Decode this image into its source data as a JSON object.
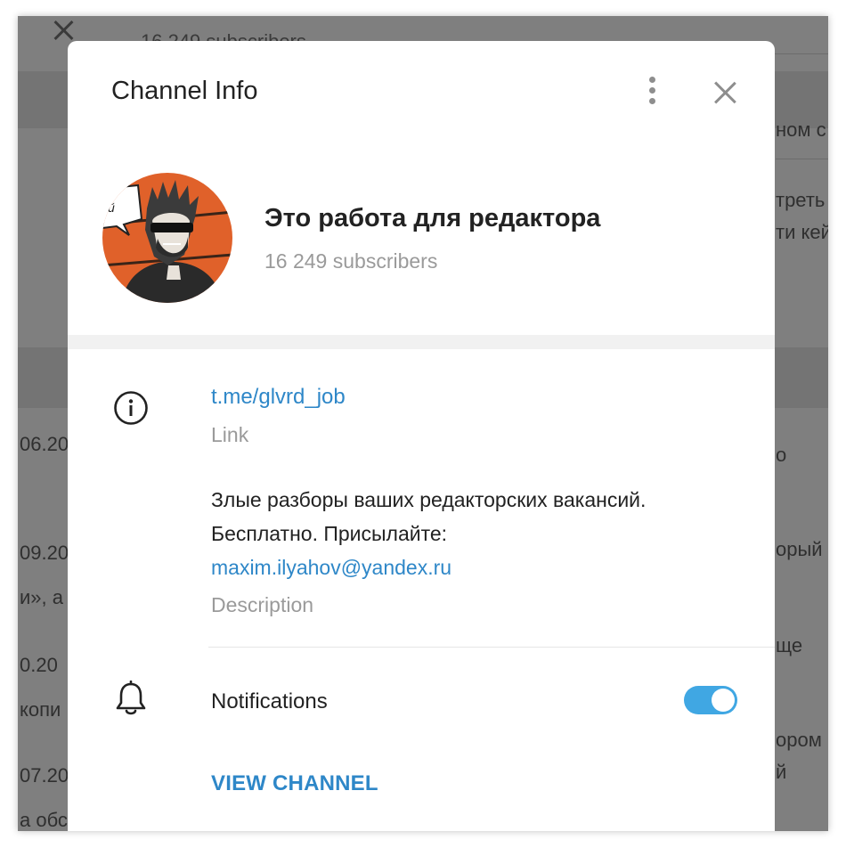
{
  "background": {
    "header_subscribers": "16 249 subscribers",
    "right_fragments": [
      "ном с",
      "треть",
      "ти кей",
      "о",
      "орый",
      "ще",
      "ором",
      "й"
    ],
    "left_fragments": [
      "06.20",
      "09.20",
      "и», а",
      "0.20",
      "копи",
      "07.20",
      "а обс"
    ]
  },
  "dialog": {
    "title": "Channel Info",
    "channel_name": "Это работа для редактора",
    "subscribers": "16 249 subscribers",
    "avatar_bubble_text": "й",
    "link": {
      "value": "t.me/glvrd_job",
      "caption": "Link"
    },
    "description": {
      "text": "Злые разборы ваших редакторских вакансий. Бесплатно. Присылайте:",
      "email": "maxim.ilyahov@yandex.ru",
      "caption": "Description"
    },
    "notifications": {
      "label": "Notifications",
      "enabled": true
    },
    "view_channel_label": "VIEW CHANNEL"
  },
  "icons": [
    "more-vertical-icon",
    "close-icon",
    "info-icon",
    "bell-icon"
  ],
  "colors": {
    "accent": "#2e87c8",
    "toggle_on": "#40a7e3",
    "avatar_bg": "#e0612a",
    "muted_text": "#9a9a9a",
    "overlay": "#7f7f7f"
  }
}
